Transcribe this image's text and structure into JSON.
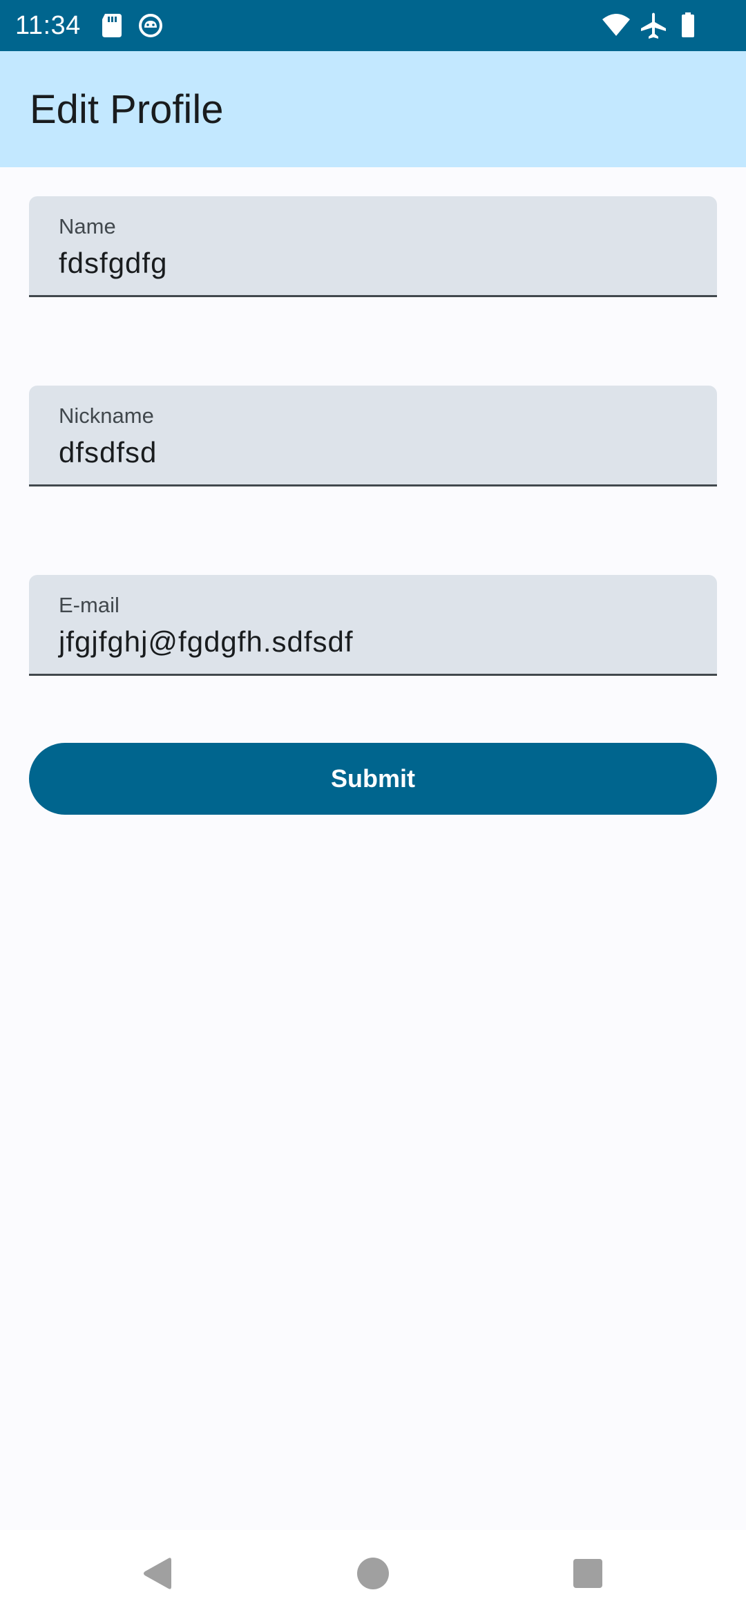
{
  "status_bar": {
    "time": "11:34",
    "icons_left": [
      "sd-card-icon",
      "android-debug-icon"
    ],
    "icons_right": [
      "wifi-icon",
      "airplane-mode-icon",
      "battery-icon"
    ],
    "background_color": "#00658e"
  },
  "app_bar": {
    "title": "Edit Profile",
    "background_color": "#c3e8ff"
  },
  "form": {
    "name": {
      "label": "Name",
      "value": "fdsfgdfg"
    },
    "nickname": {
      "label": "Nickname",
      "value": "dfsdfsd"
    },
    "email": {
      "label": "E-mail",
      "value": "jfgjfghj@fgdgfh.sdfsdf"
    },
    "submit_label": "Submit",
    "accent_color": "#00658e",
    "field_color": "#dde3ea"
  },
  "nav_bar": {
    "buttons": [
      "back-icon",
      "home-icon",
      "recents-icon"
    ]
  }
}
